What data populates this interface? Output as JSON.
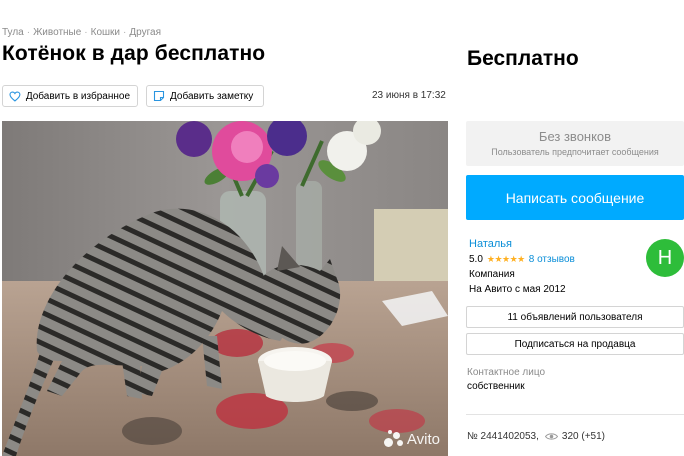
{
  "breadcrumbs": [
    "Тула",
    "Животные",
    "Кошки",
    "Другая"
  ],
  "listing": {
    "title": "Котёнок в дар бесплатно",
    "date": "23 июня в 17:32",
    "price": "Бесплатно",
    "number": "№ 2441402053,",
    "views": "320 (+51)"
  },
  "actions": {
    "favorite_label": "Добавить в избранное",
    "note_label": "Добавить заметку"
  },
  "photo": {
    "watermark": "Avito"
  },
  "contact_panel": {
    "no_calls_title": "Без звонков",
    "no_calls_subtitle": "Пользователь предпочитает сообщения",
    "write_label": "Написать сообщение"
  },
  "seller": {
    "name": "Наталья",
    "rating": "5.0",
    "stars": "★★★★★",
    "reviews": "8 отзывов",
    "type": "Компания",
    "since": "На Авито с мая 2012",
    "avatar_letter": "Н",
    "avatar_color": "#2ebd3a",
    "ads_label": "11 объявлений пользователя",
    "subscribe_label": "Подписаться на продавца",
    "contact_label": "Контактное лицо",
    "contact_value": "собственник"
  },
  "colors": {
    "accent": "#00aaff",
    "link": "#0a8ed8",
    "star": "#ffb021"
  }
}
